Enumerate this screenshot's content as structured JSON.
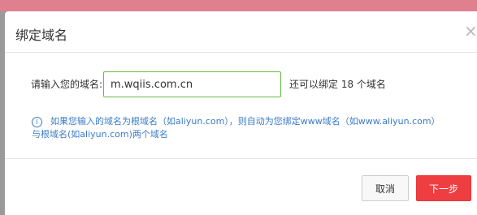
{
  "dialog": {
    "title": "绑定域名",
    "close_glyph": "×",
    "form": {
      "label": "请输入您的域名:",
      "input_value": "m.wqiis.com.cn",
      "remaining_text": "还可以绑定 18 个域名"
    },
    "hint": {
      "icon": "info-icon",
      "icon_glyph": "i",
      "line1": "如果您输入的域名为根域名（如aliyun.com），则自动为您绑定www域名（如www.aliyun.com）",
      "line2": "与根域名(如aliyun.com)两个域名"
    },
    "footer": {
      "cancel_label": "取消",
      "next_label": "下一步"
    }
  },
  "colors": {
    "accent_red": "#ef3e42",
    "input_border": "#66bb44",
    "hint_blue": "#3a7bc8"
  }
}
